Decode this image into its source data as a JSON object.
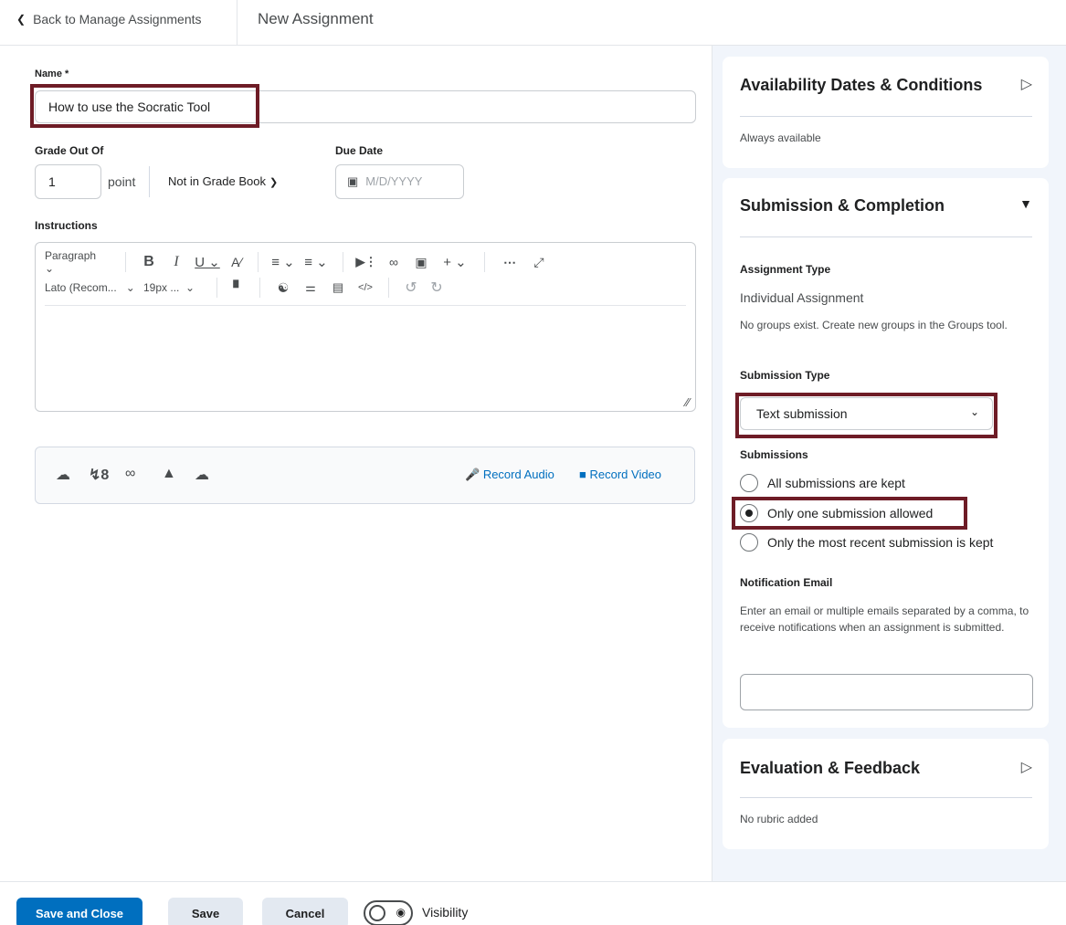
{
  "topbar": {
    "back_label": "Back to Manage Assignments",
    "title": "New Assignment"
  },
  "form": {
    "name_label": "Name *",
    "name_value": "How to use the Socratic Tool",
    "grade_label": "Grade Out Of",
    "grade_value": "1",
    "grade_unit": "point",
    "gradebook_label": "Not in Grade Book",
    "due_label": "Due Date",
    "due_placeholder": "M/D/YYYY",
    "instructions_label": "Instructions"
  },
  "editor": {
    "format_select": "Paragraph",
    "font_select": "Lato (Recom...",
    "size_select": "19px ...",
    "icons_row1": [
      "chevron-down-icon",
      "bold-icon",
      "italic-icon",
      "underline-icon",
      "font-color-icon",
      "align-icon",
      "list-icon",
      "insert-stuff-icon",
      "link-icon",
      "image-icon",
      "plus-icon",
      "more-icon",
      "fullscreen-icon"
    ],
    "icons_row2": [
      "format-painter-icon",
      "accessibility-icon",
      "divider-icon",
      "find-replace-icon",
      "source-code-icon",
      "undo-icon",
      "redo-icon"
    ]
  },
  "attachments": {
    "record_audio": "Record Audio",
    "record_video": "Record Video",
    "icons": [
      "upload-icon",
      "quicklink-icon",
      "link-icon",
      "google-drive-icon",
      "onedrive-icon"
    ]
  },
  "availability": {
    "title": "Availability Dates & Conditions",
    "status": "Always available"
  },
  "submission": {
    "title": "Submission & Completion",
    "assignment_type_label": "Assignment Type",
    "assignment_type_value": "Individual Assignment",
    "groups_note": "No groups exist. Create new groups in the Groups tool.",
    "submission_type_label": "Submission Type",
    "submission_type_value": "Text submission",
    "submissions_label": "Submissions",
    "options": [
      {
        "label": "All submissions are kept",
        "selected": false
      },
      {
        "label": "Only one submission allowed",
        "selected": true
      },
      {
        "label": "Only the most recent submission is kept",
        "selected": false
      }
    ],
    "notification_label": "Notification Email",
    "notification_note": "Enter an email or multiple emails separated by a comma, to receive notifications when an assignment is submitted."
  },
  "evaluation": {
    "title": "Evaluation & Feedback",
    "status": "No rubric added"
  },
  "footer": {
    "save_close": "Save and Close",
    "save": "Save",
    "cancel": "Cancel",
    "visibility": "Visibility"
  },
  "colors": {
    "primary": "#006fbf",
    "highlight": "#6e1c26",
    "panel_bg": "#f1f5fb"
  }
}
